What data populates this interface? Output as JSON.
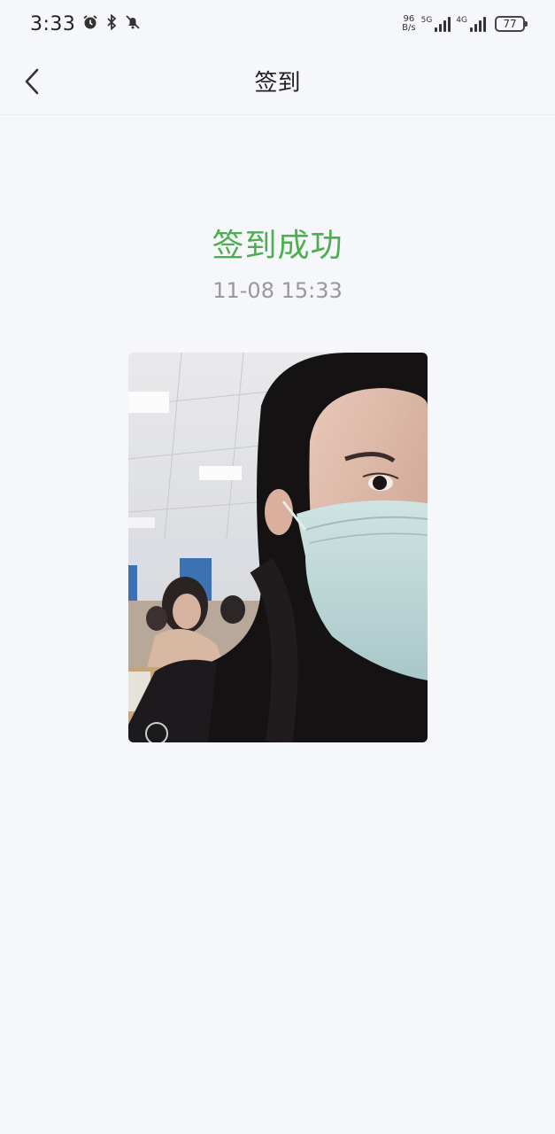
{
  "status_bar": {
    "time": "3:33",
    "net_speed_value": "96",
    "net_speed_unit": "B/s",
    "sim1_label": "5G",
    "sim2_label": "4G",
    "battery": "77"
  },
  "nav": {
    "title": "签到"
  },
  "result": {
    "title": "签到成功",
    "timestamp": "11-08 15:33",
    "title_color": "#4cae4f"
  }
}
